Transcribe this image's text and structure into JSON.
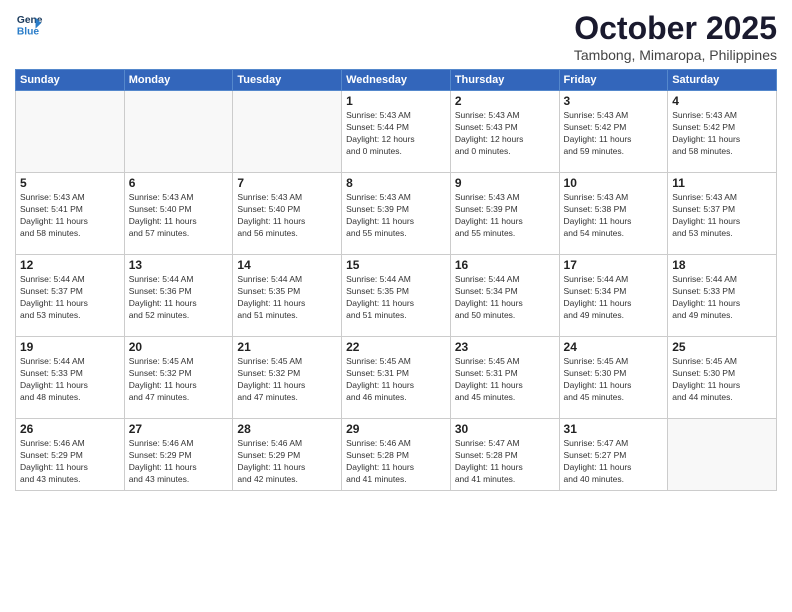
{
  "header": {
    "logo_line1": "General",
    "logo_line2": "Blue",
    "month": "October 2025",
    "location": "Tambong, Mimaropa, Philippines"
  },
  "weekdays": [
    "Sunday",
    "Monday",
    "Tuesday",
    "Wednesday",
    "Thursday",
    "Friday",
    "Saturday"
  ],
  "weeks": [
    [
      {
        "day": "",
        "info": ""
      },
      {
        "day": "",
        "info": ""
      },
      {
        "day": "",
        "info": ""
      },
      {
        "day": "1",
        "info": "Sunrise: 5:43 AM\nSunset: 5:44 PM\nDaylight: 12 hours\nand 0 minutes."
      },
      {
        "day": "2",
        "info": "Sunrise: 5:43 AM\nSunset: 5:43 PM\nDaylight: 12 hours\nand 0 minutes."
      },
      {
        "day": "3",
        "info": "Sunrise: 5:43 AM\nSunset: 5:42 PM\nDaylight: 11 hours\nand 59 minutes."
      },
      {
        "day": "4",
        "info": "Sunrise: 5:43 AM\nSunset: 5:42 PM\nDaylight: 11 hours\nand 58 minutes."
      }
    ],
    [
      {
        "day": "5",
        "info": "Sunrise: 5:43 AM\nSunset: 5:41 PM\nDaylight: 11 hours\nand 58 minutes."
      },
      {
        "day": "6",
        "info": "Sunrise: 5:43 AM\nSunset: 5:40 PM\nDaylight: 11 hours\nand 57 minutes."
      },
      {
        "day": "7",
        "info": "Sunrise: 5:43 AM\nSunset: 5:40 PM\nDaylight: 11 hours\nand 56 minutes."
      },
      {
        "day": "8",
        "info": "Sunrise: 5:43 AM\nSunset: 5:39 PM\nDaylight: 11 hours\nand 55 minutes."
      },
      {
        "day": "9",
        "info": "Sunrise: 5:43 AM\nSunset: 5:39 PM\nDaylight: 11 hours\nand 55 minutes."
      },
      {
        "day": "10",
        "info": "Sunrise: 5:43 AM\nSunset: 5:38 PM\nDaylight: 11 hours\nand 54 minutes."
      },
      {
        "day": "11",
        "info": "Sunrise: 5:43 AM\nSunset: 5:37 PM\nDaylight: 11 hours\nand 53 minutes."
      }
    ],
    [
      {
        "day": "12",
        "info": "Sunrise: 5:44 AM\nSunset: 5:37 PM\nDaylight: 11 hours\nand 53 minutes."
      },
      {
        "day": "13",
        "info": "Sunrise: 5:44 AM\nSunset: 5:36 PM\nDaylight: 11 hours\nand 52 minutes."
      },
      {
        "day": "14",
        "info": "Sunrise: 5:44 AM\nSunset: 5:35 PM\nDaylight: 11 hours\nand 51 minutes."
      },
      {
        "day": "15",
        "info": "Sunrise: 5:44 AM\nSunset: 5:35 PM\nDaylight: 11 hours\nand 51 minutes."
      },
      {
        "day": "16",
        "info": "Sunrise: 5:44 AM\nSunset: 5:34 PM\nDaylight: 11 hours\nand 50 minutes."
      },
      {
        "day": "17",
        "info": "Sunrise: 5:44 AM\nSunset: 5:34 PM\nDaylight: 11 hours\nand 49 minutes."
      },
      {
        "day": "18",
        "info": "Sunrise: 5:44 AM\nSunset: 5:33 PM\nDaylight: 11 hours\nand 49 minutes."
      }
    ],
    [
      {
        "day": "19",
        "info": "Sunrise: 5:44 AM\nSunset: 5:33 PM\nDaylight: 11 hours\nand 48 minutes."
      },
      {
        "day": "20",
        "info": "Sunrise: 5:45 AM\nSunset: 5:32 PM\nDaylight: 11 hours\nand 47 minutes."
      },
      {
        "day": "21",
        "info": "Sunrise: 5:45 AM\nSunset: 5:32 PM\nDaylight: 11 hours\nand 47 minutes."
      },
      {
        "day": "22",
        "info": "Sunrise: 5:45 AM\nSunset: 5:31 PM\nDaylight: 11 hours\nand 46 minutes."
      },
      {
        "day": "23",
        "info": "Sunrise: 5:45 AM\nSunset: 5:31 PM\nDaylight: 11 hours\nand 45 minutes."
      },
      {
        "day": "24",
        "info": "Sunrise: 5:45 AM\nSunset: 5:30 PM\nDaylight: 11 hours\nand 45 minutes."
      },
      {
        "day": "25",
        "info": "Sunrise: 5:45 AM\nSunset: 5:30 PM\nDaylight: 11 hours\nand 44 minutes."
      }
    ],
    [
      {
        "day": "26",
        "info": "Sunrise: 5:46 AM\nSunset: 5:29 PM\nDaylight: 11 hours\nand 43 minutes."
      },
      {
        "day": "27",
        "info": "Sunrise: 5:46 AM\nSunset: 5:29 PM\nDaylight: 11 hours\nand 43 minutes."
      },
      {
        "day": "28",
        "info": "Sunrise: 5:46 AM\nSunset: 5:29 PM\nDaylight: 11 hours\nand 42 minutes."
      },
      {
        "day": "29",
        "info": "Sunrise: 5:46 AM\nSunset: 5:28 PM\nDaylight: 11 hours\nand 41 minutes."
      },
      {
        "day": "30",
        "info": "Sunrise: 5:47 AM\nSunset: 5:28 PM\nDaylight: 11 hours\nand 41 minutes."
      },
      {
        "day": "31",
        "info": "Sunrise: 5:47 AM\nSunset: 5:27 PM\nDaylight: 11 hours\nand 40 minutes."
      },
      {
        "day": "",
        "info": ""
      }
    ]
  ]
}
